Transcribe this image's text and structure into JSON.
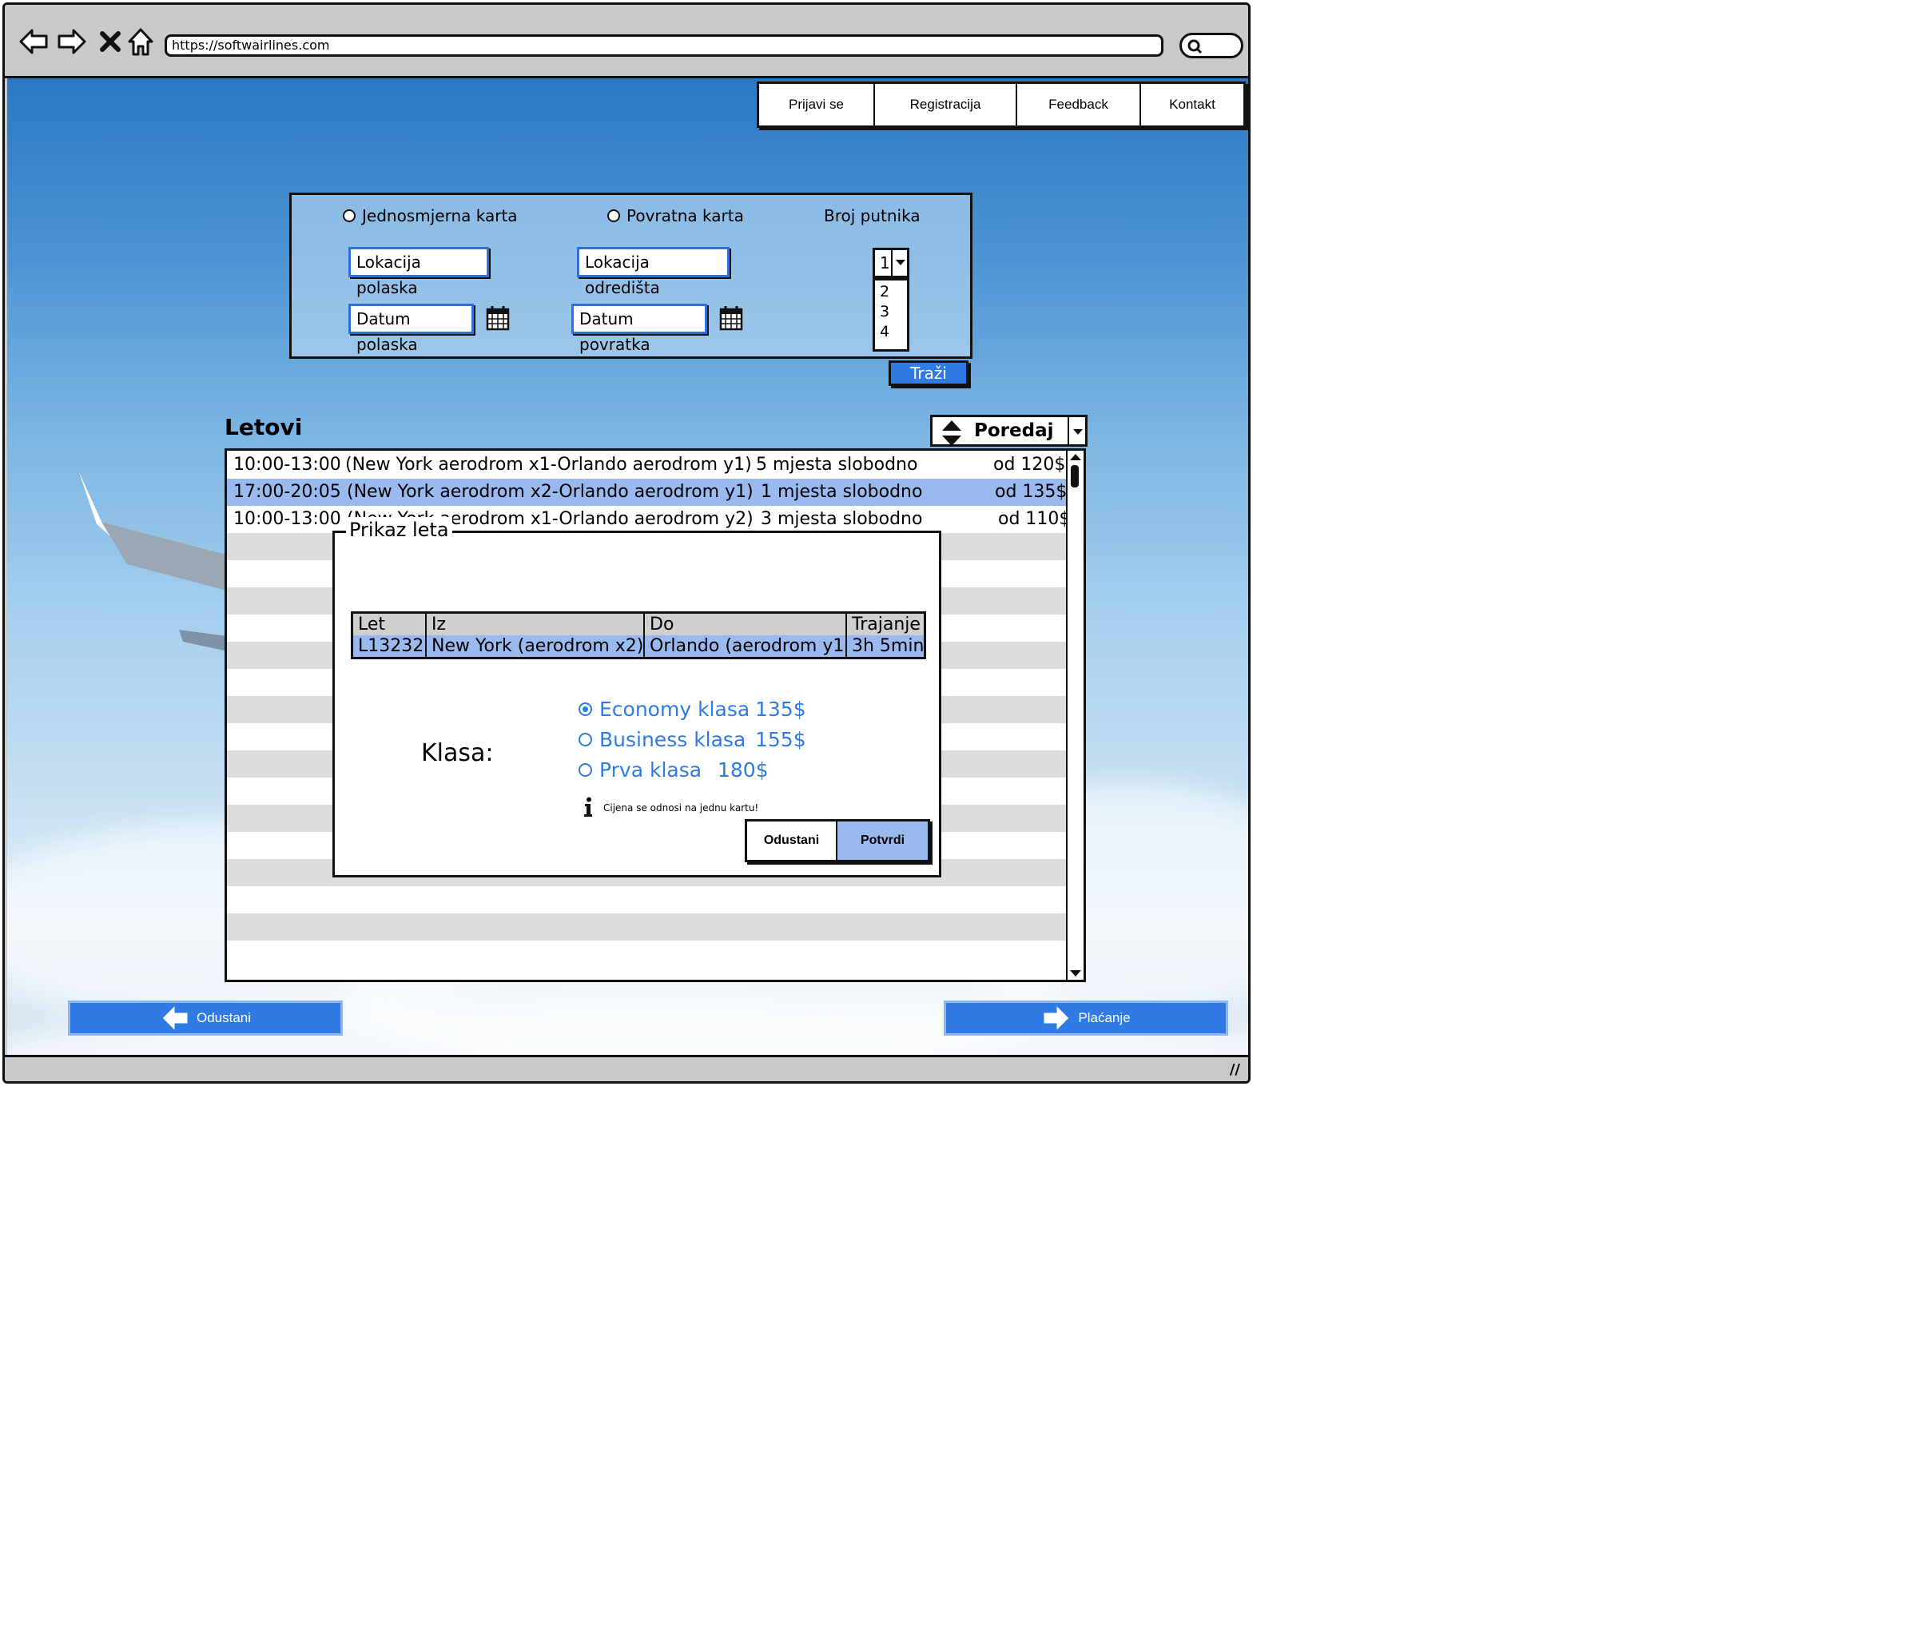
{
  "browser": {
    "url": "https://softwairlines.com",
    "nav_icons": [
      "back-arrow-icon",
      "forward-arrow-icon",
      "close-icon",
      "home-icon"
    ],
    "search_icon": "search-icon"
  },
  "top_nav": {
    "items": [
      {
        "label": "Prijavi se"
      },
      {
        "label": "Registracija"
      },
      {
        "label": "Feedback"
      },
      {
        "label": "Kontakt"
      }
    ]
  },
  "search": {
    "one_way_label": "Jednosmjerna karta",
    "return_label": "Povratna karta",
    "passengers_label": "Broj putnika",
    "departure_location": "Lokacija polaska",
    "destination_location": "Lokacija odredišta",
    "departure_date": "Datum polaska",
    "return_date": "Datum povratka",
    "passengers_selected": "1",
    "passenger_options": [
      "2",
      "3",
      "4"
    ],
    "search_button": "Traži",
    "calendar_icon": "calendar-icon"
  },
  "flights": {
    "title": "Letovi",
    "sort_label": "Poredaj po",
    "rows": [
      {
        "time": "10:00-13:00",
        "route": "(New York aerodrom x1-Orlando aerodrom y1)",
        "seats": "5 mjesta slobodno",
        "price": "od 120$",
        "selected": false
      },
      {
        "time": "17:00-20:05",
        "route": "(New York aerodrom x2-Orlando aerodrom y1)",
        "seats": "1 mjesta slobodno",
        "price": "od 135$",
        "selected": true
      },
      {
        "time": "10:00-13:00",
        "route": "(New York aerodrom x1-Orlando aerodrom y2)",
        "seats": "3 mjesta slobodno",
        "price": "od 110$",
        "selected": false
      }
    ]
  },
  "modal": {
    "title": "Prikaz leta",
    "table": {
      "headers": [
        "Let",
        "Iz",
        "Do",
        "Trajanje"
      ],
      "values": [
        "L13232",
        "New York (aerodrom x2)",
        "Orlando (aerodrom y1)",
        "3h 5min"
      ]
    },
    "class_label": "Klasa:",
    "options": [
      {
        "label": "Economy klasa",
        "price": "135$",
        "selected": true
      },
      {
        "label": "Business klasa",
        "price": "155$",
        "selected": false
      },
      {
        "label": "Prva klasa",
        "price": "180$",
        "selected": false
      }
    ],
    "info_text": "Cijena se odnosi na jednu kartu!",
    "info_icon": "info-icon",
    "cancel_button": "Odustani",
    "confirm_button": "Potvrdi"
  },
  "footer": {
    "back_button": "Odustani",
    "next_button": "Plaćanje"
  },
  "colors": {
    "accent": "#2f7ae5",
    "selected_row": "#9ab9ee",
    "stripe": "#dddddd",
    "frame": "#c9c9c9"
  }
}
